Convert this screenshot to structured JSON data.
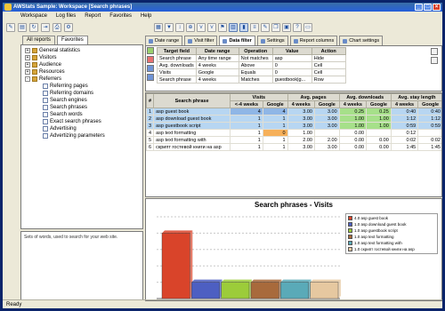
{
  "window": {
    "title": "AWStats Sample: Workspace [Search phrases]"
  },
  "menu": [
    "Workspace",
    "Log files",
    "Report",
    "Favorites",
    "Help"
  ],
  "left_tabs": [
    "All reports",
    "Favorites"
  ],
  "tree": [
    {
      "label": "General statistics",
      "level": 0,
      "expand": "+"
    },
    {
      "label": "Visitors",
      "level": 0,
      "expand": "+"
    },
    {
      "label": "Audience",
      "level": 0,
      "expand": "+"
    },
    {
      "label": "Resources",
      "level": 0,
      "expand": "+"
    },
    {
      "label": "Referrers",
      "level": 0,
      "expand": "-"
    },
    {
      "label": "Referring pages",
      "level": 1
    },
    {
      "label": "Referring domains",
      "level": 1
    },
    {
      "label": "Search engines",
      "level": 1
    },
    {
      "label": "Search phrases",
      "level": 1,
      "selected": true
    },
    {
      "label": "Search words",
      "level": 1
    },
    {
      "label": "Exact search phrases",
      "level": 1
    },
    {
      "label": "Advertising",
      "level": 1
    },
    {
      "label": "Advertizing parameters",
      "level": 1
    }
  ],
  "description": "Sets of words, used to search for your web site.",
  "status": "Ready",
  "right_tabs": [
    "Date range",
    "Visit filter",
    "Data filter",
    "Settings",
    "Report columns",
    "Chart settings"
  ],
  "filter": {
    "headers": [
      "Target field",
      "Date range",
      "Operation",
      "Value",
      "Action"
    ],
    "rows": [
      [
        "Search phrase",
        "Any time range",
        "Not matches",
        "asp",
        "Hide"
      ],
      [
        "Avg. downloads",
        "4 weeks",
        "Above",
        "0",
        "Cell"
      ],
      [
        "Visits",
        "Google",
        "Equals",
        "0",
        "Cell"
      ],
      [
        "Search phrase",
        "4 weeks",
        "Matches",
        "guestbook|g...",
        "Row"
      ]
    ]
  },
  "results": {
    "group_headers": [
      "#",
      "Search phrase",
      "Visits",
      "Avg. pages",
      "Avg. downloads",
      "Avg. stay length"
    ],
    "sub_headers": [
      "<-4 weeks",
      "Google",
      "4 weeks",
      "Google",
      "4 weeks",
      "Google",
      "4 weeks",
      "Google"
    ],
    "rows": [
      {
        "n": "1",
        "phrase": "asp guest book",
        "v": [
          "4",
          "4",
          "3.00",
          "3.00",
          "0.25",
          "0.25",
          "0:40",
          "0:40"
        ]
      },
      {
        "n": "2",
        "phrase": "asp download guest book",
        "v": [
          "1",
          "1",
          "3.00",
          "3.00",
          "1.00",
          "1.00",
          "1:12",
          "1:12"
        ]
      },
      {
        "n": "3",
        "phrase": "asp guestbook script",
        "v": [
          "1",
          "1",
          "3.00",
          "3.00",
          "1.00",
          "1.00",
          "0:59",
          "0:59"
        ]
      },
      {
        "n": "4",
        "phrase": "asp text formatting",
        "v": [
          "1",
          "0",
          "1.00",
          "",
          "0.00",
          "",
          "0:12",
          ""
        ]
      },
      {
        "n": "5",
        "phrase": "asp text formatting with",
        "v": [
          "1",
          "1",
          "2.00",
          "2.00",
          "0.00",
          "0.00",
          "0:02",
          "0:02"
        ]
      },
      {
        "n": "6",
        "phrase": "скрипт гостевой книги на asp",
        "v": [
          "1",
          "1",
          "3.00",
          "3.00",
          "0.00",
          "0.00",
          "1:45",
          "1:45"
        ]
      }
    ]
  },
  "chart_data": {
    "type": "bar",
    "title": "Search phrases - Visits",
    "categories": [
      "asp guest book",
      "asp download guest book",
      "asp guestbook script",
      "asp text formatting",
      "asp text formatting with",
      "скрипт гостевой книги на asp"
    ],
    "values": [
      4,
      1,
      1,
      1,
      1,
      1
    ],
    "legend": [
      "4.0 asp guest book",
      "1.0 asp download guest book",
      "1.0 asp guestbook script",
      "1.0 asp text formatting",
      "1.0 asp text formatting with",
      "1.0 скрипт гостевой книги на asp"
    ],
    "colors": [
      "#d9442a",
      "#4d5fc2",
      "#9ccc3a",
      "#a86a3c",
      "#5aaab8",
      "#e6c8a0"
    ],
    "ylim": [
      0,
      5
    ],
    "legend_position": "top-right",
    "grid": true
  }
}
